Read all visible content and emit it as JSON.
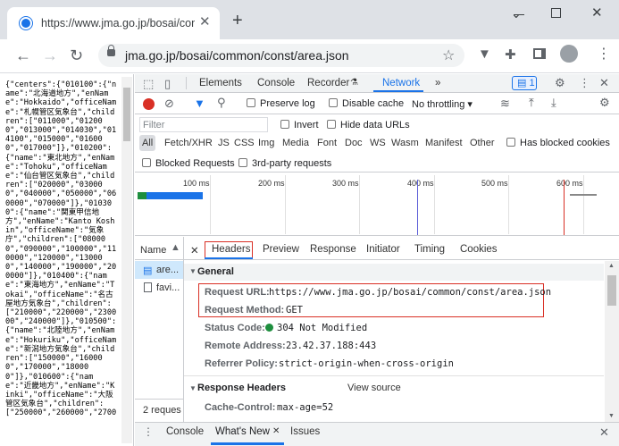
{
  "browser": {
    "tab_title": "https://www.jma.go.jp/bosai/com",
    "address": "jma.go.jp/bosai/common/const/area.json"
  },
  "json_text": "{\"centers\":{\"010100\":{\"name\":\"北海道地方\",\"enName\":\"Hokkaido\",\"officeName\":\"札幌管区気象台\",\"children\":[\"011000\",\"012000\",\"013000\",\"014030\",\"014100\",\"015000\",\"016000\",\"017000\"]},\"010200\":{\"name\":\"東北地方\",\"enName\":\"Tohoku\",\"officeName\":\"仙台管区気象台\",\"children\":[\"020000\",\"030000\",\"040000\",\"050000\",\"060000\",\"070000\"]},\"010300\":{\"name\":\"関東甲信地方\",\"enName\":\"Kanto Koshin\",\"officeName\":\"気象庁\",\"children\":[\"080000\",\"090000\",\"100000\",\"110000\",\"120000\",\"130000\",\"140000\",\"190000\",\"200000\"]},\"010400\":{\"name\":\"東海地方\",\"enName\":\"Tokai\",\"officeName\":\"名古屋地方気象台\",\"children\":[\"210000\",\"220000\",\"230000\",\"240000\"]},\"010500\":{\"name\":\"北陸地方\",\"enName\":\"Hokuriku\",\"officeName\":\"新潟地方気象台\",\"children\":[\"150000\",\"160000\",\"170000\",\"180000\"]},\"010600\":{\"name\":\"近畿地方\",\"enName\":\"Kinki\",\"officeName\":\"大阪管区気象台\",\"children\":[\"250000\",\"260000\",\"2700",
  "devtools": {
    "tabs": [
      "Elements",
      "Console",
      "Recorder",
      "Network"
    ],
    "active_tab": "Network",
    "badge": "1",
    "preserve_log": "Preserve log",
    "disable_cache": "Disable cache",
    "throttling": "No throttling",
    "filter_placeholder": "Filter",
    "invert": "Invert",
    "hide_data_urls": "Hide data URLs",
    "types": [
      "All",
      "Fetch/XHR",
      "JS",
      "CSS",
      "Img",
      "Media",
      "Font",
      "Doc",
      "WS",
      "Wasm",
      "Manifest",
      "Other"
    ],
    "has_blocked_cookies": "Has blocked cookies",
    "blocked_requests": "Blocked Requests",
    "third_party": "3rd-party requests",
    "ticks": [
      "100 ms",
      "200 ms",
      "300 ms",
      "400 ms",
      "500 ms",
      "600 ms"
    ],
    "name_col": "Name",
    "requests": [
      "are...",
      "favi..."
    ],
    "footer": "2 reques",
    "detail_tabs": [
      "Headers",
      "Preview",
      "Response",
      "Initiator",
      "Timing",
      "Cookies"
    ],
    "general": {
      "title": "General",
      "request_url_key": "Request URL:",
      "request_url": "https://www.jma.go.jp/bosai/common/const/area.json",
      "method_key": "Request Method:",
      "method": "GET",
      "status_key": "Status Code:",
      "status": "304 Not Modified",
      "remote_key": "Remote Address:",
      "remote": "23.42.37.188:443",
      "referrer_key": "Referrer Policy:",
      "referrer": "strict-origin-when-cross-origin"
    },
    "response_headers": {
      "title": "Response Headers",
      "view_source": "View source",
      "cache_key": "Cache-Control:",
      "cache": "max-age=52"
    },
    "drawer_tabs": [
      "Console",
      "What's New",
      "Issues"
    ]
  }
}
